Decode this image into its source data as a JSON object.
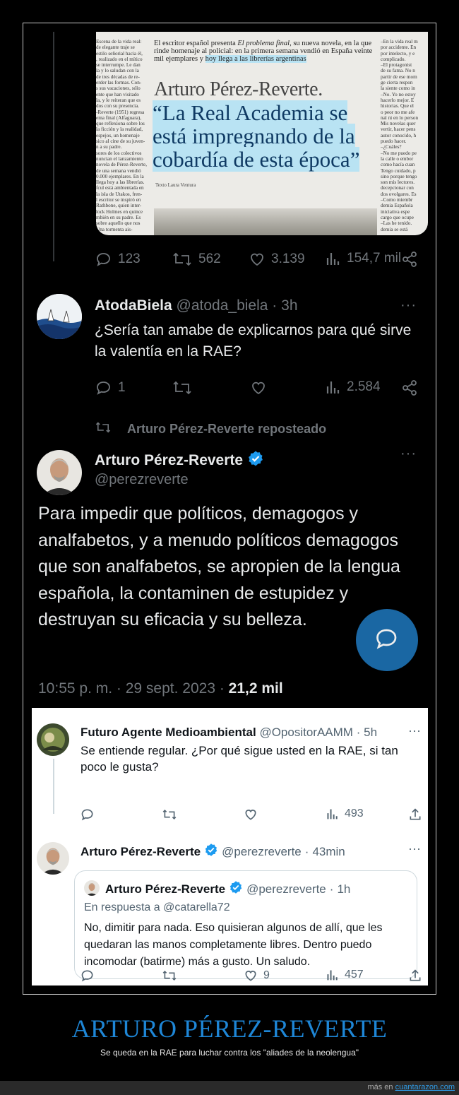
{
  "colors": {
    "dark_bg": "#000000",
    "verified": "#1d9bf0",
    "banner_title": "#1e86d6",
    "link": "#2f9be6"
  },
  "clipping": {
    "left_column": "Escena de la vida real:\nde elegante traje se\nestilo señorial hacia él,\n, realizado en el mítico\nse interrumpe. Le dan\nla y lo saludan con la\nde tres décadas de re-\nerder las formas. Con-\ns sus vacaciones, sólo\nente que han visitado\nla, y le reiteran que es\ndos con su presencia.\n-Reverte (1951) regresa\nema final (Alfaguara),\nque reflexiona sobre los\nla ficción y la realidad,\nespejos, un homenaje\nsico al cine de su juven-\nn a su padre.\nsores de los colectivos\nnuncian el lanzamiento\nnovela de Pérez-Reverte,\nde una semana vendió\n0.000 ejemplares. En la\nllega hoy a las librerías.\nfcul está ambientada en\nla isla de Utakos, fren-\nl escritor se inspiró en\nRathbone, quien inter-\nlock Holmes en quince\nmbién en su padre. Es\nsobre aquello que nos\nUna tormenta ais-",
    "intro_plain": "El escritor español presenta ",
    "intro_title": "El problema final",
    "intro_rest": ", su nueva novela, en la que rinde homenaje al policial: en la primera semana vendió en España veinte mil ejemplares y ",
    "intro_highlight": "hoy llega a las librerías argentinas",
    "author": "Arturo Pérez-Reverte.",
    "headline": "“La Real Academia se está impregnando de la cobardía de esta época”",
    "credit": "Texto Laura Ventura",
    "right_column": "–En la vida real m\npor accidente. En\npor intelecto, y e\ncomplicado.\n–El protagonist\nde su fama. No n\npartir de ese mom\nge cierta respon\nla siente como in\n–No. Yo no estoy\nhacerlo mejor. E\nhistorias. Que el\no peor no me afe\nnal ni en lo person\nMis novelas quer\nvertir, hacer pens\nautor conocido, h\npuedo hacer.\n–¿Cuáles?\n–No me puedo pe\nla calle o embor\ncomo hacía cuan\nTengo cuidado, p\nsino porque tengo\nson mis lectores.\ndecepcionar con\ndos ovolgares. Es\n–Como miembr\ndemia Española\niniciativa espe\ncargo que ocupe\n–Las he tenido.\ndemia se está"
  },
  "tweet1_actions": {
    "replies": "123",
    "retweets": "562",
    "likes": "3.139",
    "views": "154,7 mil"
  },
  "reply1": {
    "name": "AtodaBiela",
    "handle": "@atoda_biela",
    "time": "3h",
    "text": "¿Sería tan amabe de explicarnos para qué sirve la valentía en la RAE?",
    "replies": "1",
    "views": "2.584"
  },
  "repost": {
    "label": "Arturo Pérez-Reverte reposteado",
    "name": "Arturo Pérez-Reverte",
    "handle": "@perezreverte",
    "text": "Para impedir que políticos, demagogos y analfabetos, y a menudo políticos demagogos que son analfabetos, se apropien de la lengua española, la contaminen de estupidez y destruyan su eficacia y su belleza.",
    "timestamp": "10:55 p. m. · 29 sept. 2023 · ",
    "views_count": "21,2 mil"
  },
  "reply2": {
    "name": "Futuro Agente Medioambiental",
    "handle": "@OpositorAAMM",
    "time": "5h",
    "text": "Se entiende regular. ¿Por qué sigue usted en la RAE, si tan poco le gusta?",
    "views": "493"
  },
  "reply3": {
    "name": "Arturo Pérez-Reverte",
    "handle": "@perezreverte",
    "time": "43min",
    "likes": "9",
    "views": "457"
  },
  "quoted": {
    "name": "Arturo Pérez-Reverte",
    "handle": "@perezreverte",
    "time": "1h",
    "in_reply_prefix": "En respuesta a ",
    "in_reply_user": "@catarella72",
    "text": "No, dimitir para nada. Eso quisieran algunos de allí, que les quedaran las manos completamente libres. Dentro puedo incomodar (batirme) más a gusto. Un saludo."
  },
  "banner": {
    "title": "ARTURO PÉREZ-REVERTE",
    "subtitle": "Se queda en la RAE para luchar contra los \"aliades de la neolengua\""
  },
  "footer": {
    "prefix": "más en ",
    "site": "cuantarazon.com"
  }
}
